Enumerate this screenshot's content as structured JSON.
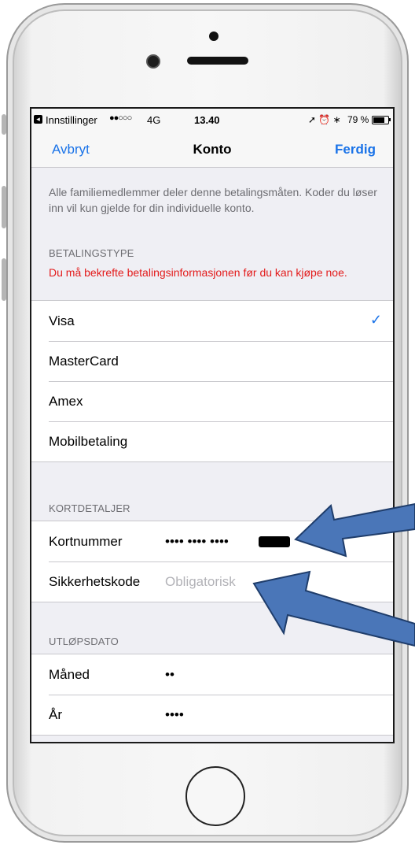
{
  "status_bar": {
    "back_app": "Innstillinger",
    "signal": "●●○○○",
    "network": "4G",
    "time": "13.40",
    "right_icons": "➚ ⏰ ∗",
    "battery_percent": "79 %",
    "battery_level": 0.79
  },
  "nav": {
    "cancel_label": "Avbryt",
    "title": "Konto",
    "done_label": "Ferdig"
  },
  "info_text": "Alle familiemedlemmer deler denne betalingsmåten. Koder du løser inn vil kun gjelde for din individuelle konto.",
  "payment_section": {
    "header": "BETALINGSTYPE",
    "warning": "Du må bekrefte betalingsinformasjonen før du kan kjøpe noe.",
    "options": [
      {
        "label": "Visa",
        "selected": true
      },
      {
        "label": "MasterCard",
        "selected": false
      },
      {
        "label": "Amex",
        "selected": false
      },
      {
        "label": "Mobilbetaling",
        "selected": false
      }
    ],
    "check_glyph": "✓"
  },
  "card_section": {
    "header": "KORTDETALJER",
    "card_number_label": "Kortnummer",
    "card_number_value": "•••• •••• ••••",
    "security_code_label": "Sikkerhetskode",
    "security_code_placeholder": "Obligatorisk"
  },
  "expiry_section": {
    "header": "UTLØPSDATO",
    "month_label": "Måned",
    "month_value": "••",
    "year_label": "År",
    "year_value": "••••"
  },
  "colors": {
    "accent": "#1a73e8",
    "warning": "#e31b1b",
    "arrow": "#4a76b8"
  }
}
